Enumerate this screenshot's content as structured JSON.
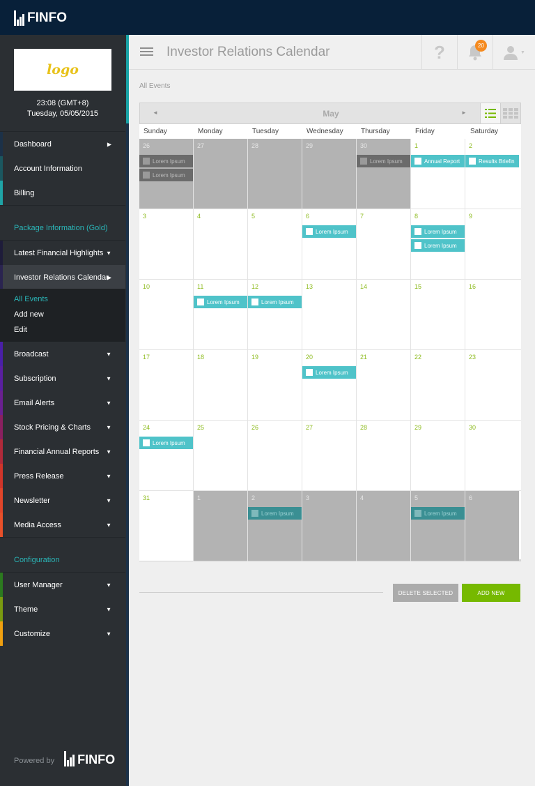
{
  "brand": {
    "name": "FINFO"
  },
  "header": {
    "title": "Investor Relations Calendar",
    "help": "?",
    "notifications": "20"
  },
  "sidebar": {
    "logo": "logo",
    "time": "23:08 (GMT+8)",
    "date": "Tuesday, 05/05/2015",
    "items": [
      {
        "label": "Dashboard"
      },
      {
        "label": "Account Information"
      },
      {
        "label": "Billing"
      }
    ],
    "package_label": "Package Information (Gold)",
    "package_items": [
      {
        "label": "Latest Financial Highlights"
      },
      {
        "label": "Investor Relations Calendar"
      }
    ],
    "submenu": [
      {
        "label": "All Events"
      },
      {
        "label": "Add new"
      },
      {
        "label": "Edit"
      }
    ],
    "feature_items": [
      {
        "label": "Broadcast"
      },
      {
        "label": "Subscription"
      },
      {
        "label": "Email Alerts"
      },
      {
        "label": "Stock Pricing & Charts"
      },
      {
        "label": "Financial Annual Reports"
      },
      {
        "label": "Press Release"
      },
      {
        "label": "Newsletter"
      },
      {
        "label": "Media Access"
      }
    ],
    "config_label": "Configuration",
    "config_items": [
      {
        "label": "User Manager"
      },
      {
        "label": "Theme"
      },
      {
        "label": "Customize"
      }
    ],
    "powered_by": "Powered by"
  },
  "breadcrumb": "All Events",
  "calendar": {
    "month": "May",
    "prev": "◄",
    "next": "►",
    "weekdays": [
      "Sunday",
      "Monday",
      "Tuesday",
      "Wednesday",
      "Thursday",
      "Friday",
      "Saturday"
    ],
    "weeks": [
      [
        {
          "day": "26",
          "other": true,
          "events": [
            {
              "title": "Lorem Ipsum",
              "style": "dark"
            },
            {
              "title": "Lorem Ipsum",
              "style": "dark"
            }
          ]
        },
        {
          "day": "27",
          "other": true,
          "events": []
        },
        {
          "day": "28",
          "other": true,
          "events": []
        },
        {
          "day": "29",
          "other": true,
          "events": []
        },
        {
          "day": "30",
          "other": true,
          "events": [
            {
              "title": "Lorem Ipsum",
              "style": "dark"
            }
          ]
        },
        {
          "day": "1",
          "other": false,
          "events": [
            {
              "title": "Annual Report",
              "style": "teal"
            }
          ]
        },
        {
          "day": "2",
          "other": false,
          "events": [
            {
              "title": "Results Briefin",
              "style": "teal"
            }
          ]
        }
      ],
      [
        {
          "day": "3",
          "other": false,
          "events": []
        },
        {
          "day": "4",
          "other": false,
          "events": []
        },
        {
          "day": "5",
          "other": false,
          "events": []
        },
        {
          "day": "6",
          "other": false,
          "events": [
            {
              "title": "Lorem Ipsum",
              "style": "teal"
            }
          ]
        },
        {
          "day": "7",
          "other": false,
          "events": []
        },
        {
          "day": "8",
          "other": false,
          "events": [
            {
              "title": "Lorem Ipsum",
              "style": "teal"
            },
            {
              "title": "Lorem Ipsum",
              "style": "teal"
            }
          ]
        },
        {
          "day": "9",
          "other": false,
          "events": []
        }
      ],
      [
        {
          "day": "10",
          "other": false,
          "events": []
        },
        {
          "day": "11",
          "other": false,
          "events": [
            {
              "title": "Lorem Ipsum",
              "style": "teal"
            }
          ]
        },
        {
          "day": "12",
          "other": false,
          "events": [
            {
              "title": "Lorem Ipsum",
              "style": "teal"
            }
          ]
        },
        {
          "day": "13",
          "other": false,
          "events": []
        },
        {
          "day": "14",
          "other": false,
          "events": []
        },
        {
          "day": "15",
          "other": false,
          "events": []
        },
        {
          "day": "16",
          "other": false,
          "events": []
        }
      ],
      [
        {
          "day": "17",
          "other": false,
          "events": []
        },
        {
          "day": "18",
          "other": false,
          "events": []
        },
        {
          "day": "19",
          "other": false,
          "events": []
        },
        {
          "day": "20",
          "other": false,
          "events": [
            {
              "title": "Lorem Ipsum",
              "style": "teal"
            }
          ]
        },
        {
          "day": "21",
          "other": false,
          "events": []
        },
        {
          "day": "22",
          "other": false,
          "events": []
        },
        {
          "day": "23",
          "other": false,
          "events": []
        }
      ],
      [
        {
          "day": "24",
          "other": false,
          "events": [
            {
              "title": "Lorem Ipsum",
              "style": "teal"
            }
          ]
        },
        {
          "day": "25",
          "other": false,
          "events": []
        },
        {
          "day": "26",
          "other": false,
          "events": []
        },
        {
          "day": "27",
          "other": false,
          "events": []
        },
        {
          "day": "28",
          "other": false,
          "events": []
        },
        {
          "day": "29",
          "other": false,
          "events": []
        },
        {
          "day": "30",
          "other": false,
          "events": []
        }
      ],
      [
        {
          "day": "31",
          "other": false,
          "events": []
        },
        {
          "day": "1",
          "other": true,
          "events": []
        },
        {
          "day": "2",
          "other": true,
          "events": [
            {
              "title": "Lorem Ipsum",
              "style": "dteal"
            }
          ]
        },
        {
          "day": "3",
          "other": true,
          "events": []
        },
        {
          "day": "4",
          "other": true,
          "events": []
        },
        {
          "day": "5",
          "other": true,
          "events": [
            {
              "title": "Lorem Ipsum",
              "style": "dteal"
            }
          ]
        },
        {
          "day": "6",
          "other": true,
          "events": []
        }
      ]
    ]
  },
  "actions": {
    "delete": "DELETE SELECTED",
    "add": "ADD NEW"
  },
  "colors": {
    "accent_green": "#76b900",
    "teal": "#4fc3c9",
    "navy": "#082039",
    "orange_badge": "#f58a1f"
  }
}
